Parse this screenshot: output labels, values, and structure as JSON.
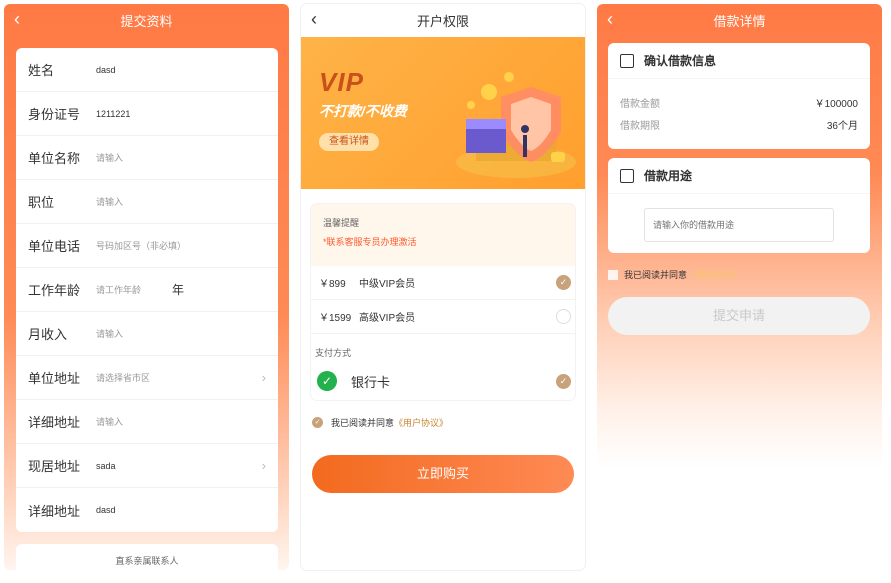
{
  "panel1": {
    "title": "提交资料",
    "rows": [
      {
        "label": "姓名",
        "value": "dasd",
        "placeholder": false,
        "chevron": false,
        "unit": ""
      },
      {
        "label": "身份证号",
        "value": "1211221",
        "placeholder": false,
        "chevron": false,
        "unit": ""
      },
      {
        "label": "单位名称",
        "value": "请输入",
        "placeholder": true,
        "chevron": false,
        "unit": ""
      },
      {
        "label": "职位",
        "value": "请输入",
        "placeholder": true,
        "chevron": false,
        "unit": ""
      },
      {
        "label": "单位电话",
        "value": "号码加区号（非必填）",
        "placeholder": true,
        "chevron": false,
        "unit": ""
      },
      {
        "label": "工作年龄",
        "value": "请工作年龄",
        "placeholder": true,
        "chevron": false,
        "unit": "年"
      },
      {
        "label": "月收入",
        "value": "请输入",
        "placeholder": true,
        "chevron": false,
        "unit": ""
      },
      {
        "label": "单位地址",
        "value": "请选择省市区",
        "placeholder": true,
        "chevron": true,
        "unit": ""
      },
      {
        "label": "详细地址",
        "value": "请输入",
        "placeholder": true,
        "chevron": false,
        "unit": ""
      },
      {
        "label": "现居地址",
        "value": "sada",
        "placeholder": false,
        "chevron": true,
        "unit": ""
      },
      {
        "label": "详细地址",
        "value": "dasd",
        "placeholder": false,
        "chevron": false,
        "unit": ""
      }
    ],
    "contact_title": "直系亲属联系人"
  },
  "panel2": {
    "title": "开户权限",
    "banner": {
      "vip": "VIP",
      "slogan": "不打款/不收费",
      "details_button": "查看详情"
    },
    "notice_title": "温馨提醒",
    "notice_text": "*联系客服专员办理激活",
    "plans": [
      {
        "price": "￥899",
        "name": "中级VIP会员",
        "selected": true
      },
      {
        "price": "￥1599",
        "name": "高级VIP会员",
        "selected": false
      }
    ],
    "pay_label": "支付方式",
    "pay_method": "银行卡",
    "agree_text": "我已阅读并同意",
    "agree_link": "《用户协议》",
    "buy_button": "立即购买"
  },
  "panel3": {
    "title": "借款详情",
    "confirm_title": "确认借款信息",
    "info": [
      {
        "key": "借款金额",
        "value": "￥100000"
      },
      {
        "key": "借款期限",
        "value": "36个月"
      }
    ],
    "purpose_title": "借款用途",
    "purpose_placeholder": "请输入你的借款用途",
    "agree_text": "我已阅读并同意",
    "agree_link": "《借款协议》",
    "submit_button": "提交申请"
  },
  "colors": {
    "accent": "#ff7a45",
    "gold": "#c7a27a",
    "wechat_green": "#22b14c"
  }
}
